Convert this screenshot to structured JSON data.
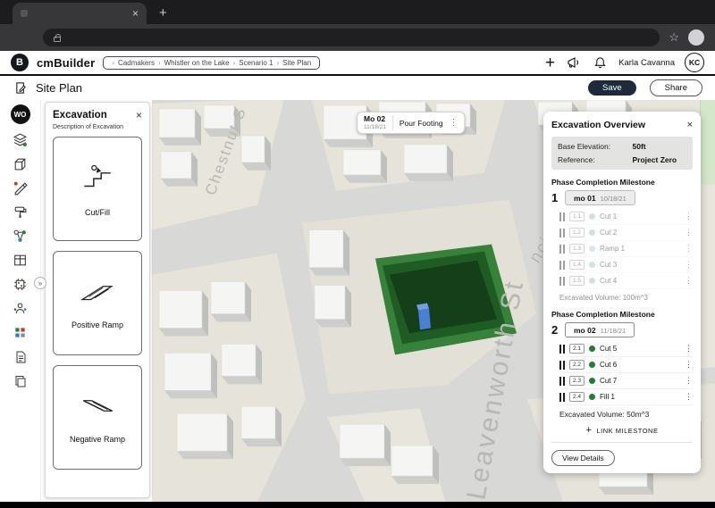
{
  "browser": {
    "close_tab_glyph": "×",
    "new_tab_glyph": "+",
    "bookmark_glyph": "☆"
  },
  "header": {
    "logo_letter": "B",
    "brand": "cmBuilder",
    "breadcrumb_sep": "›",
    "breadcrumbs": [
      "Cadmakers",
      "Whistler on the Lake",
      "Scenario 1",
      "Site Plan"
    ],
    "add_glyph": "+",
    "user_name": "Karla Cavanna",
    "user_initials": "KC"
  },
  "toolbar": {
    "page_title": "Site Plan",
    "save_label": "Save",
    "share_label": "Share"
  },
  "rail": {
    "workspace_badge": "WO",
    "expander_glyph": "»"
  },
  "left_panel": {
    "title": "Excavation",
    "close_glyph": "×",
    "subtitle": "Description of Excavation",
    "options": [
      {
        "label": "Cut/Fill"
      },
      {
        "label": "Positive Ramp"
      },
      {
        "label": "Negative Ramp"
      }
    ]
  },
  "map": {
    "chip": {
      "milestone": "Mo 02",
      "date": "11/18/21",
      "task": "Pour Footing",
      "menu_glyph": "⋮"
    },
    "streets": {
      "main": "Leavenworth St",
      "top_left": "Chestnut S",
      "top_right": "ncisco"
    }
  },
  "right_panel": {
    "title": "Excavation Overview",
    "close_glyph": "×",
    "info": {
      "base_elevation_label": "Base Elevation:",
      "base_elevation_value": "50ft",
      "reference_label": "Reference:",
      "reference_value": "Project Zero"
    },
    "section_label": "Phase Completion Milestone",
    "item_menu_glyph": "⋮",
    "phases": [
      {
        "number": "1",
        "milestone": "mo 01",
        "date": "10/18/21",
        "items": [
          {
            "id": "1.1",
            "label": "Cut 1",
            "dot": "#9fbca1"
          },
          {
            "id": "1.2",
            "label": "Cut 2",
            "dot": "#9fbca1"
          },
          {
            "id": "1.3",
            "label": "Ramp 1",
            "dot": "#a5c4de"
          },
          {
            "id": "1.4",
            "label": "Cut 3",
            "dot": "#9fbca1"
          },
          {
            "id": "1.5",
            "label": "Cut 4",
            "dot": "#9fbca1"
          }
        ],
        "volume_label": "Excavated Volume:",
        "volume_value": "100m^3"
      },
      {
        "number": "2",
        "milestone": "mo 02",
        "date": "11/18/21",
        "items": [
          {
            "id": "2.1",
            "label": "Cut 5",
            "dot": "#1e7e34"
          },
          {
            "id": "2.2",
            "label": "Cut 6",
            "dot": "#1e7e34"
          },
          {
            "id": "2.3",
            "label": "Cut 7",
            "dot": "#1e7e34"
          },
          {
            "id": "2.4",
            "label": "Fill 1",
            "dot": "#1e7e34"
          }
        ],
        "volume_label": "Excavated Volume:",
        "volume_value": "50m^3"
      }
    ],
    "link_plus_glyph": "+",
    "link_milestone_label": "LINK MILESTONE",
    "view_details_label": "View Details"
  },
  "colors": {
    "accent_green": "#1e7e34",
    "pit_green_dark": "#143f18",
    "save_button_bg": "#1c2a3a"
  }
}
